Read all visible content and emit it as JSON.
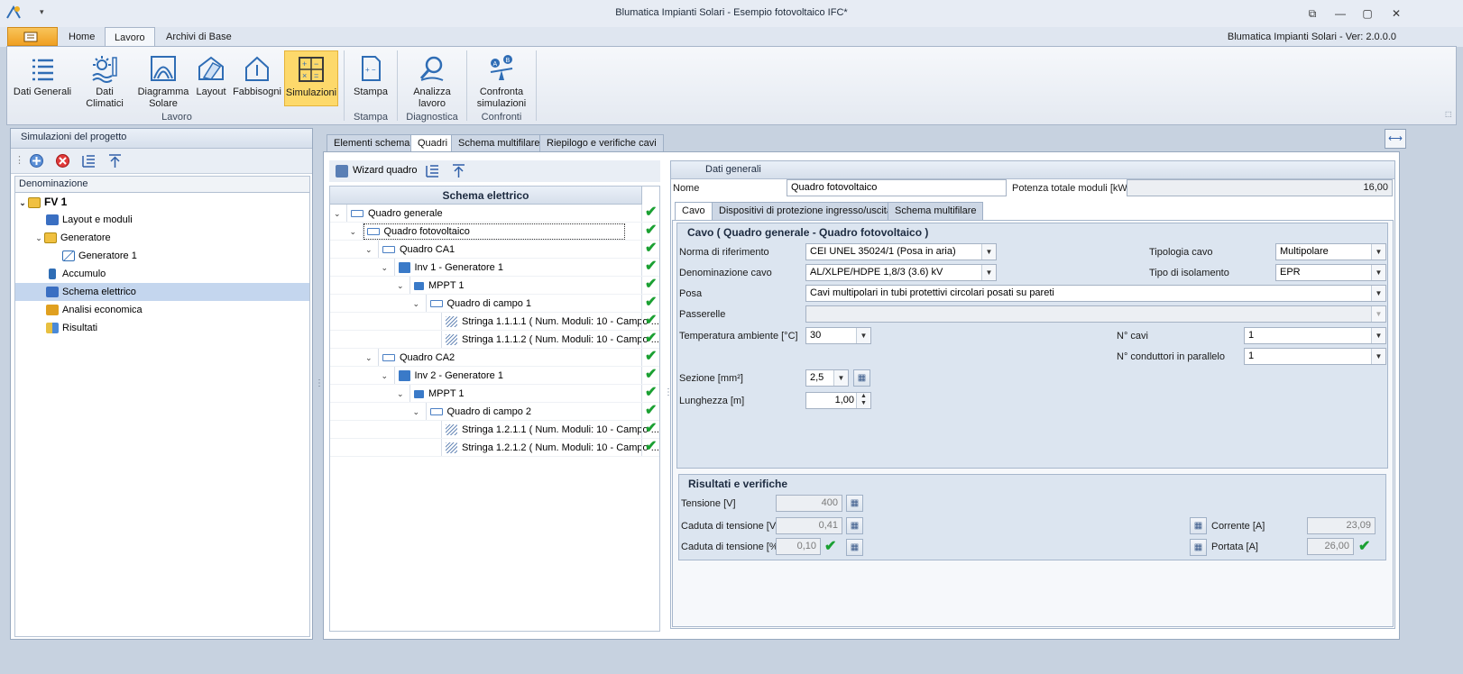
{
  "titlebar": {
    "title": "Blumatica Impianti Solari - Esempio fotovoltaico IFC*",
    "version": "Blumatica Impianti Solari - Ver: 2.0.0.0"
  },
  "ribbon_tabs": [
    "Home",
    "Lavoro",
    "Archivi di Base"
  ],
  "ribbon": {
    "lavoro": [
      "Dati Generali",
      "Dati Climatici",
      "Diagramma\nSolare",
      "Layout",
      "Fabbisogni",
      "Simulazioni"
    ],
    "stampa": [
      "Stampa"
    ],
    "diagnostica": [
      "Analizza\nlavoro"
    ],
    "confronti": [
      "Confronta\nsimulazioni"
    ],
    "groups": [
      "Lavoro",
      "Stampa",
      "Diagnostica",
      "Confronti"
    ]
  },
  "left": {
    "header": "Simulazioni del progetto",
    "column": "Denominazione",
    "tree": [
      "FV 1",
      "Layout e moduli",
      "Generatore",
      "Generatore 1",
      "Accumulo",
      "Schema elettrico",
      "Analisi economica",
      "Risultati"
    ]
  },
  "tabs": [
    "Elementi schema",
    "Quadri",
    "Schema multifilare",
    "Riepilogo e verifiche cavi"
  ],
  "wizard": "Wizard quadro",
  "schema": {
    "header": "Schema elettrico",
    "rows": [
      "Quadro generale",
      "Quadro fotovoltaico",
      "Quadro CA1",
      "Inv 1 - Generatore 1",
      "MPPT 1",
      "Quadro di campo 1",
      "Stringa 1.1.1.1 ( Num. Moduli: 10 - Campo ...",
      "Stringa 1.1.1.2 ( Num. Moduli: 10 - Campo ...",
      "Quadro CA2",
      "Inv 2 - Generatore 1",
      "MPPT 1",
      "Quadro di campo 2",
      "Stringa 1.2.1.1 ( Num. Moduli: 10 - Campo ...",
      "Stringa 1.2.1.2 ( Num. Moduli: 10 - Campo ..."
    ]
  },
  "dati": {
    "header": "Dati generali",
    "nome_label": "Nome",
    "nome": "Quadro fotovoltaico",
    "potenza_label": "Potenza totale moduli [kW]",
    "potenza": "16,00",
    "subtabs": [
      "Cavo",
      "Dispositivi di protezione ingresso/uscita",
      "Schema multifilare"
    ],
    "cavo_title": "Cavo ( Quadro generale - Quadro fotovoltaico )",
    "norma_label": "Norma di riferimento",
    "norma": "CEI UNEL 35024/1 (Posa in aria)",
    "tipologia_label": "Tipologia cavo",
    "tipologia": "Multipolare",
    "denom_label": "Denominazione cavo",
    "denom": "AL/XLPE/HDPE  1,8/3 (3.6) kV",
    "isol_label": "Tipo di isolamento",
    "isol": "EPR",
    "posa_label": "Posa",
    "posa": "Cavi multipolari in tubi protettivi circolari posati su pareti",
    "passerelle_label": "Passerelle",
    "temp_label": "Temperatura ambiente [°C]",
    "temp": "30",
    "ncavi_label": "N° cavi",
    "ncavi": "1",
    "ncond_label": "N° conduttori in parallelo",
    "ncond": "1",
    "sezione_label": "Sezione [mm²]",
    "sezione": "2,5",
    "lung_label": "Lunghezza [m]",
    "lung": "1,00"
  },
  "risultati": {
    "title": "Risultati e verifiche",
    "tensione_label": "Tensione [V]",
    "tensione": "400",
    "cdt_v_label": "Caduta di tensione [V]",
    "cdt_v": "0,41",
    "cdt_p_label": "Caduta di tensione [%]",
    "cdt_p": "0,10",
    "corrente_label": "Corrente [A]",
    "corrente": "23,09",
    "portata_label": "Portata [A]",
    "portata": "26,00"
  },
  "icons": {
    "check": "✔"
  }
}
